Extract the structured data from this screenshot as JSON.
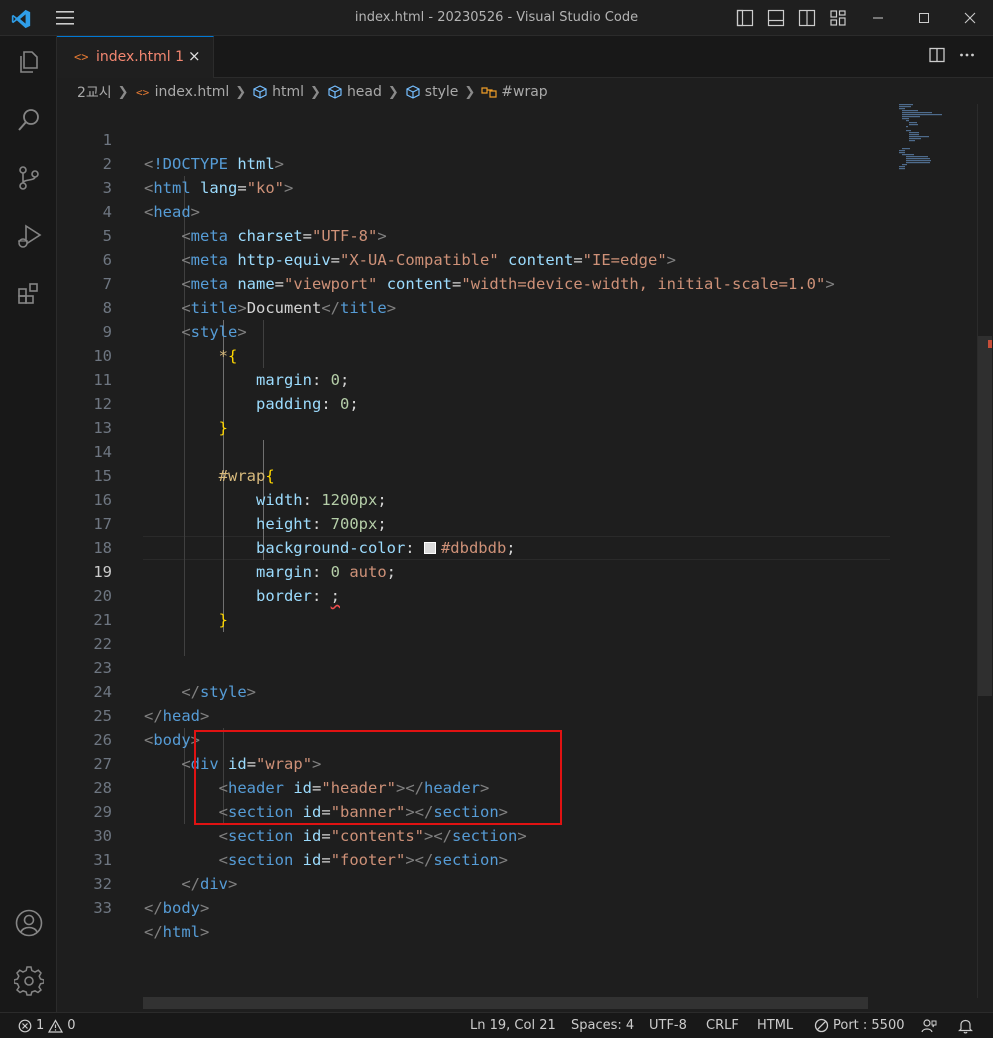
{
  "window": {
    "title": "index.html - 20230526 - Visual Studio Code"
  },
  "tab": {
    "label": "index.html 1",
    "close": "×"
  },
  "breadcrumb": {
    "folder": "2교시",
    "file": "index.html",
    "items": [
      "html",
      "head",
      "style",
      "#wrap"
    ]
  },
  "editor": {
    "active_line": 19,
    "lines": [
      {
        "n": "1"
      },
      {
        "n": "2"
      },
      {
        "n": "3"
      },
      {
        "n": "4"
      },
      {
        "n": "5"
      },
      {
        "n": "6"
      },
      {
        "n": "7"
      },
      {
        "n": "8"
      },
      {
        "n": "9"
      },
      {
        "n": "10"
      },
      {
        "n": "11"
      },
      {
        "n": "12"
      },
      {
        "n": "13"
      },
      {
        "n": "14"
      },
      {
        "n": "15"
      },
      {
        "n": "16"
      },
      {
        "n": "17"
      },
      {
        "n": "18"
      },
      {
        "n": "19"
      },
      {
        "n": "20"
      },
      {
        "n": "21"
      },
      {
        "n": "22"
      },
      {
        "n": "23"
      },
      {
        "n": "24"
      },
      {
        "n": "25"
      },
      {
        "n": "26"
      },
      {
        "n": "27"
      },
      {
        "n": "28"
      },
      {
        "n": "29"
      },
      {
        "n": "30"
      },
      {
        "n": "31"
      },
      {
        "n": "32"
      },
      {
        "n": "33"
      }
    ],
    "tokens": {
      "doctype": "!DOCTYPE",
      "html": "html",
      "lang_attr": "lang",
      "lang_val": "\"ko\"",
      "head": "head",
      "meta": "meta",
      "charset_attr": "charset",
      "charset_val": "\"UTF-8\"",
      "http_equiv_attr": "http-equiv",
      "http_equiv_val": "\"X-UA-Compatible\"",
      "content_attr": "content",
      "ie_val": "\"IE=edge\"",
      "name_attr": "name",
      "viewport_val": "\"viewport\"",
      "viewport_content_val": "\"width=device-width, initial-scale=1.0\"",
      "title": "title",
      "title_text": "Document",
      "style": "style",
      "star_selector": "*",
      "margin": "margin",
      "padding": "padding",
      "zero": "0",
      "wrap_selector": "#wrap",
      "width": "width",
      "width_val": "1200px",
      "height": "height",
      "height_val": "700px",
      "background_color": "background-color",
      "bg_val": "#dbdbdb",
      "auto": "auto",
      "border": "border",
      "body": "body",
      "div": "div",
      "id_attr": "id",
      "wrap_val": "\"wrap\"",
      "header": "header",
      "header_val": "\"header\"",
      "section": "section",
      "banner_val": "\"banner\"",
      "contents_val": "\"contents\"",
      "footer_val": "\"footer\""
    }
  },
  "statusbar": {
    "errors": "1",
    "warnings": "0",
    "position": "Ln 19, Col 21",
    "spaces": "Spaces: 4",
    "encoding": "UTF-8",
    "eol": "CRLF",
    "language": "HTML",
    "port": "Port : 5500"
  },
  "colors": {
    "accent": "#0078d4",
    "tab_error_text": "#f48771",
    "highlight_box": "#e01212",
    "swatch": "#dbdbdb"
  }
}
